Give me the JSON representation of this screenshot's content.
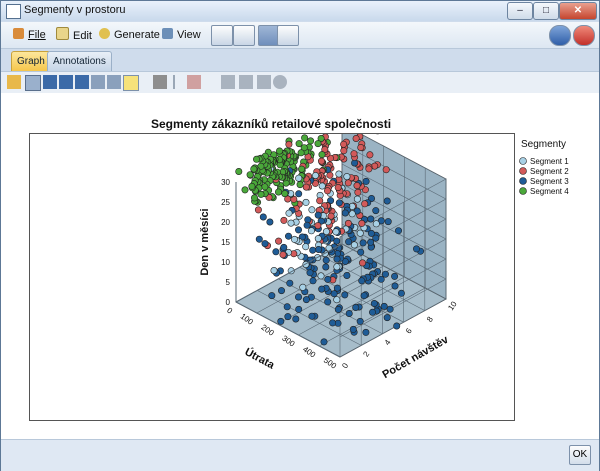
{
  "window": {
    "title": "Segmenty v prostoru"
  },
  "menu": {
    "file": "File",
    "edit": "Edit",
    "generate": "Generate",
    "view": "View"
  },
  "tabs": {
    "graph": "Graph",
    "annotations": "Annotations"
  },
  "footer": {
    "ok": "OK"
  },
  "colors": {
    "segment1": "#a8d1e6",
    "segment2": "#d25a5a",
    "segment3": "#1f5c96",
    "segment4": "#4aa83a",
    "wall": "#8fa9ba"
  },
  "chart_data": {
    "type": "scatter",
    "projection": "3d",
    "title": "Segmenty zákazníků retailové společnosti",
    "xlabel": "Útrata",
    "ylabel": "Počet návštěv",
    "zlabel": "Den v měsíci",
    "xlim": [
      0,
      500
    ],
    "ylim": [
      0,
      10
    ],
    "zlim": [
      0,
      30
    ],
    "xticks": [
      "0",
      "100",
      "200",
      "300",
      "400",
      "500"
    ],
    "yticks": [
      "0",
      "2",
      "4",
      "6",
      "8",
      "10"
    ],
    "zticks": [
      "0",
      "5",
      "10",
      "15",
      "20",
      "25",
      "30"
    ],
    "legend_title": "Segmenty",
    "legend_position": "right",
    "series": [
      {
        "name": "Segment 1",
        "color": "#a8d1e6",
        "centroid": {
          "x": 150,
          "y": 5,
          "z": 16
        },
        "spread": {
          "x": 70,
          "y": 2,
          "z": 6
        },
        "count": 60
      },
      {
        "name": "Segment 2",
        "color": "#d25a5a",
        "centroid": {
          "x": 90,
          "y": 7,
          "z": 22
        },
        "spread": {
          "x": 70,
          "y": 2,
          "z": 7
        },
        "count": 120
      },
      {
        "name": "Segment 3",
        "color": "#1f5c96",
        "centroid": {
          "x": 330,
          "y": 3,
          "z": 16
        },
        "spread": {
          "x": 110,
          "y": 2.5,
          "z": 9
        },
        "count": 170
      },
      {
        "name": "Segment 4",
        "color": "#4aa83a",
        "centroid": {
          "x": 60,
          "y": 3,
          "z": 31
        },
        "spread": {
          "x": 45,
          "y": 1.5,
          "z": 3
        },
        "count": 150
      }
    ]
  }
}
